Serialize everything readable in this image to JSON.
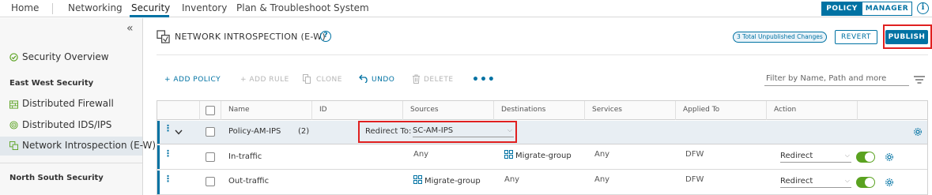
{
  "nav": {
    "items": [
      "Home",
      "Networking",
      "Security",
      "Inventory",
      "Plan & Troubleshoot",
      "System"
    ],
    "active": "Security",
    "toggle": {
      "policy": "POLICY",
      "manager": "MANAGER"
    },
    "info": "i"
  },
  "sidebar": {
    "collapse": "«",
    "overview": "Security Overview",
    "ew_heading": "East West Security",
    "items": [
      "Distributed Firewall",
      "Distributed IDS/IPS",
      "Network Introspection (E-W)"
    ],
    "ns_heading": "North South Security"
  },
  "header": {
    "title": "NETWORK INTROSPECTION (E-W)",
    "help": "?",
    "unpublished": "3 Total Unpublished Changes",
    "revert": "REVERT",
    "publish": "PUBLISH"
  },
  "toolbar": {
    "add_policy": "+ ADD POLICY",
    "add_rule": "+ ADD RULE",
    "clone": "CLONE",
    "undo": "UNDO",
    "delete": "DELETE",
    "more": "•••",
    "filter_placeholder": "Filter by Name, Path and more"
  },
  "table": {
    "columns": [
      "Name",
      "ID",
      "Sources",
      "Destinations",
      "Services",
      "Applied To",
      "Action"
    ],
    "policy": {
      "name": "Policy-AM-IPS",
      "count": "(2)",
      "redirect_label": "Redirect To:",
      "redirect_value": "SC-AM-IPS"
    },
    "rules": [
      {
        "name": "In-traffic",
        "sources": "Any",
        "destinations": "Migrate-group",
        "services": "Any",
        "applied_to": "DFW",
        "action": "Redirect",
        "enabled": true
      },
      {
        "name": "Out-traffic",
        "sources": "Migrate-group",
        "destinations": "Any",
        "services": "Any",
        "applied_to": "DFW",
        "action": "Redirect",
        "enabled": true
      }
    ]
  },
  "colors": {
    "accent": "#0072a3",
    "highlight": "#e02020",
    "toggle_on": "#5aa220"
  }
}
